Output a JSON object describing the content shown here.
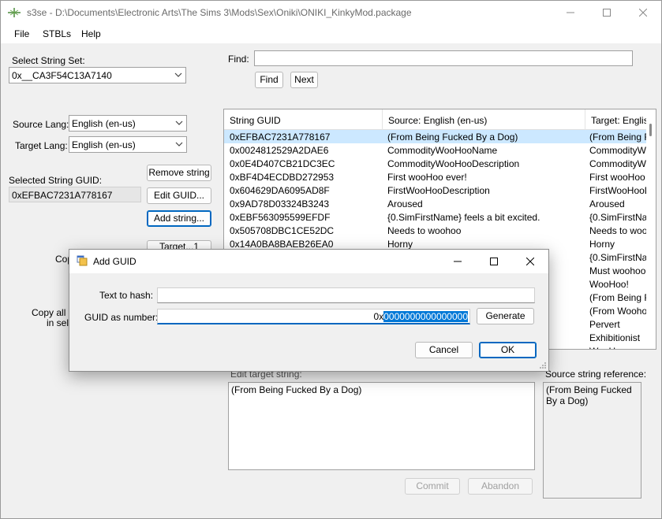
{
  "window": {
    "title": "s3se - D:\\Documents\\Electronic Arts\\The Sims 3\\Mods\\Sex\\Oniki\\ONIKI_KinkyMod.package"
  },
  "menu": [
    "File",
    "STBLs",
    "Help"
  ],
  "left_panel": {
    "select_string_set_label": "Select String Set:",
    "string_set_value": "0x__CA3F54C13A7140",
    "source_lang_label": "Source Lang:",
    "source_lang_value": "English (en-us)",
    "target_lang_label": "Target Lang:",
    "target_lang_value": "English (en-us)",
    "selected_guid_label": "Selected String GUID:",
    "selected_guid_value": "0xEFBAC7231A778167",
    "remove_string_label": "Remove string",
    "edit_guid_label": "Edit GUID...",
    "add_string_label": "Add string...",
    "target_button_label": "Target...1",
    "copy_partial_label": "Cop",
    "copy_all_label_1": "Copy all S",
    "copy_all_label_2": "in sele"
  },
  "find": {
    "label": "Find:",
    "value": "",
    "find_button": "Find",
    "next_button": "Next"
  },
  "grid": {
    "columns": [
      "String GUID",
      "Source: English (en-us)",
      "Target: English"
    ],
    "rows": [
      {
        "guid": "0xEFBAC7231A778167",
        "source": "(From Being Fucked By a Dog)",
        "target": "(From Being Fu",
        "selected": true
      },
      {
        "guid": "0x0024812529A2DAE6",
        "source": "CommodityWooHooName",
        "target": "CommodityWo"
      },
      {
        "guid": "0x0E4D407CB21DC3EC",
        "source": "CommodityWooHooDescription",
        "target": "CommodityWo"
      },
      {
        "guid": "0xBF4D4ECDBD272953",
        "source": "First wooHoo ever!",
        "target": "First wooHoo e"
      },
      {
        "guid": "0x604629DA6095AD8F",
        "source": "FirstWooHooDescription",
        "target": "FirstWooHooD"
      },
      {
        "guid": "0x9AD78D03324B3243",
        "source": "Aroused",
        "target": "Aroused"
      },
      {
        "guid": "0xEBF563095599EFDF",
        "source": "{0.SimFirstName} feels a bit excited.",
        "target": "{0.SimFirstNam"
      },
      {
        "guid": "0x505708DBC1CE52DC",
        "source": "Needs to woohoo",
        "target": "Needs to wooh"
      },
      {
        "guid": "0x14A0BA8BAEB26EA0",
        "source": "Horny",
        "target": "Horny"
      },
      {
        "guid": "",
        "source": "",
        "target": "{0.SimFirstNam"
      },
      {
        "guid": "",
        "source": "",
        "target": "Must woohoo."
      },
      {
        "guid": "",
        "source": "",
        "target": "WooHoo!"
      },
      {
        "guid": "",
        "source": "",
        "target": "(From Being Fu"
      },
      {
        "guid": "",
        "source": "",
        "target": "(From Woohoo"
      },
      {
        "guid": "",
        "source": "",
        "target": "Pervert"
      },
      {
        "guid": "",
        "source": "",
        "target": "Exhibitionist"
      },
      {
        "guid": "",
        "source": "",
        "target": "WooHoo"
      }
    ]
  },
  "edit_target": {
    "label": "Edit target string:",
    "value": "(From Being Fucked By a Dog)"
  },
  "source_ref": {
    "label": "Source string reference:",
    "value": "(From Being Fucked By a Dog)"
  },
  "bottom_buttons": {
    "commit": "Commit",
    "abandon": "Abandon"
  },
  "dialog": {
    "title": "Add GUID",
    "text_to_hash_label": "Text to hash:",
    "text_to_hash_value": "",
    "guid_label": "GUID as number:",
    "guid_prefix": "0x",
    "guid_digits": "0000000000000000",
    "generate_label": "Generate",
    "cancel_label": "Cancel",
    "ok_label": "OK"
  },
  "colors": {
    "accent": "#0067c0",
    "selection": "#cce8ff",
    "text_selection": "#0078d7"
  }
}
